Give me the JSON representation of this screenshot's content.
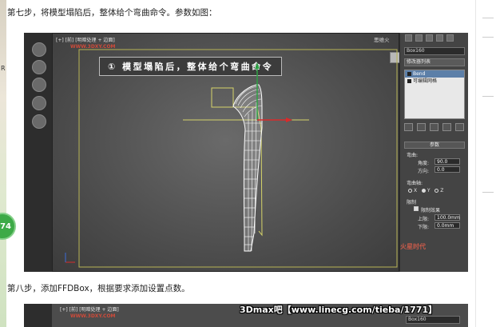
{
  "article": {
    "step7": "第七步，将模型塌陷后，整体给个弯曲命令。参数如图：",
    "step8": "第八步，添加FFDBox，根据要求添加设置点数。"
  },
  "page": {
    "left_edge_text": "R",
    "badge": "74"
  },
  "screenshot1": {
    "viewport_label": "[+] [前] [明暗处理 + 边面]",
    "watermark": "WWW.3DXY.COM",
    "title_banner": "① 模型塌陷后，整体给个弯曲命令",
    "top_bar": "思维火",
    "panel": {
      "object_name": "Box160",
      "modifier_list": "修改器列表",
      "stack": [
        "Bend",
        "可编辑网格"
      ],
      "rollout": "参数",
      "bend_group": "弯曲:",
      "angle_label": "角度:",
      "angle_value": "90.0",
      "direction_label": "方向:",
      "direction_value": "0.0",
      "axis_group": "弯曲轴:",
      "axes": [
        "X",
        "Y",
        "Z"
      ],
      "limits_group": "限制",
      "limit_effect": "限制效果",
      "upper_label": "上限:",
      "upper_value": "100.0mm",
      "lower_label": "下限:",
      "lower_value": "0.0mm"
    },
    "logo": "火星时代"
  },
  "screenshot2": {
    "viewport_label": "[+] [前] [明暗处理 + 边面]",
    "watermark": "WWW.3DXY.COM",
    "object_name": "Box160"
  },
  "site_watermark": "3Dmax吧【www.linecg.com/tieba/1771】",
  "colors": {
    "viewport_bg": "#595959",
    "panel_bg": "#444444",
    "mesh": "#ffffff",
    "gizmo": "#d6d46a",
    "axis_x": "#d92b2b",
    "axis_y": "#2ea044",
    "stack_selected": "#5c7fa8"
  }
}
